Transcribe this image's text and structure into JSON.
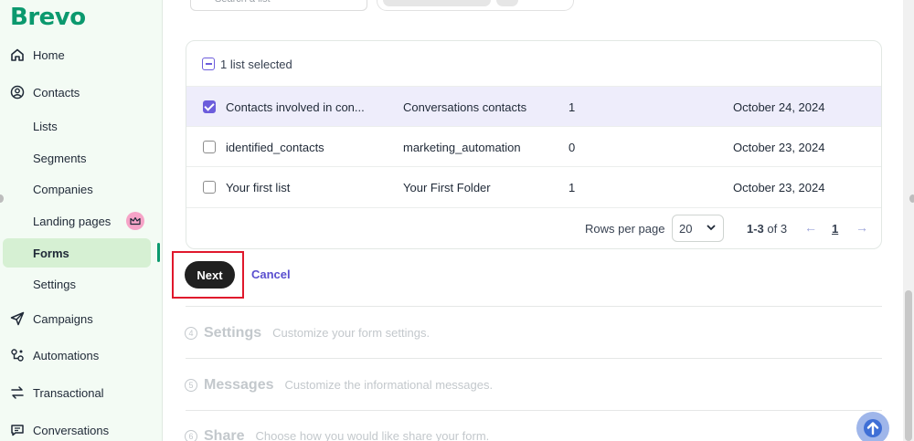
{
  "brand": {
    "name": "Brevo",
    "color": "#0b996e"
  },
  "sidebar": {
    "items": [
      {
        "label": "Home",
        "icon": "home-icon"
      },
      {
        "label": "Contacts",
        "icon": "contacts-icon"
      },
      {
        "label": "Lists"
      },
      {
        "label": "Segments"
      },
      {
        "label": "Companies"
      },
      {
        "label": "Landing pages",
        "badge": "crown-icon"
      },
      {
        "label": "Forms",
        "active": true
      },
      {
        "label": "Settings"
      },
      {
        "label": "Campaigns",
        "icon": "send-icon"
      },
      {
        "label": "Automations",
        "icon": "automations-icon"
      },
      {
        "label": "Transactional",
        "icon": "transactional-icon"
      },
      {
        "label": "Conversations",
        "icon": "conversations-icon"
      }
    ]
  },
  "top_partial": {
    "search_placeholder": "Search a list"
  },
  "table": {
    "selection_text": "1 list selected",
    "rows": [
      {
        "name": "Contacts involved in con...",
        "folder": "Conversations contacts",
        "count": "1",
        "date": "October 24, 2024",
        "checked": true
      },
      {
        "name": "identified_contacts",
        "folder": "marketing_automation",
        "count": "0",
        "date": "October 23, 2024",
        "checked": false
      },
      {
        "name": "Your first list",
        "folder": "Your First Folder",
        "count": "1",
        "date": "October 23, 2024",
        "checked": false
      }
    ],
    "pagination": {
      "rows_per_page_label": "Rows per page",
      "rows_per_page_value": "20",
      "range": "1-3",
      "of_text": "of 3",
      "current_page": "1"
    }
  },
  "actions": {
    "next_label": "Next",
    "cancel_label": "Cancel"
  },
  "steps": [
    {
      "number": "4",
      "title": "Settings",
      "description": "Customize your form settings."
    },
    {
      "number": "5",
      "title": "Messages",
      "description": "Customize the informational messages."
    },
    {
      "number": "6",
      "title": "Share",
      "description": "Choose how you would like share your form."
    }
  ],
  "colors": {
    "accent": "#6c5ddc",
    "highlight": "#e0182c",
    "selected_row": "#eeedfb",
    "sidebar_bg": "#f3fbf4"
  }
}
